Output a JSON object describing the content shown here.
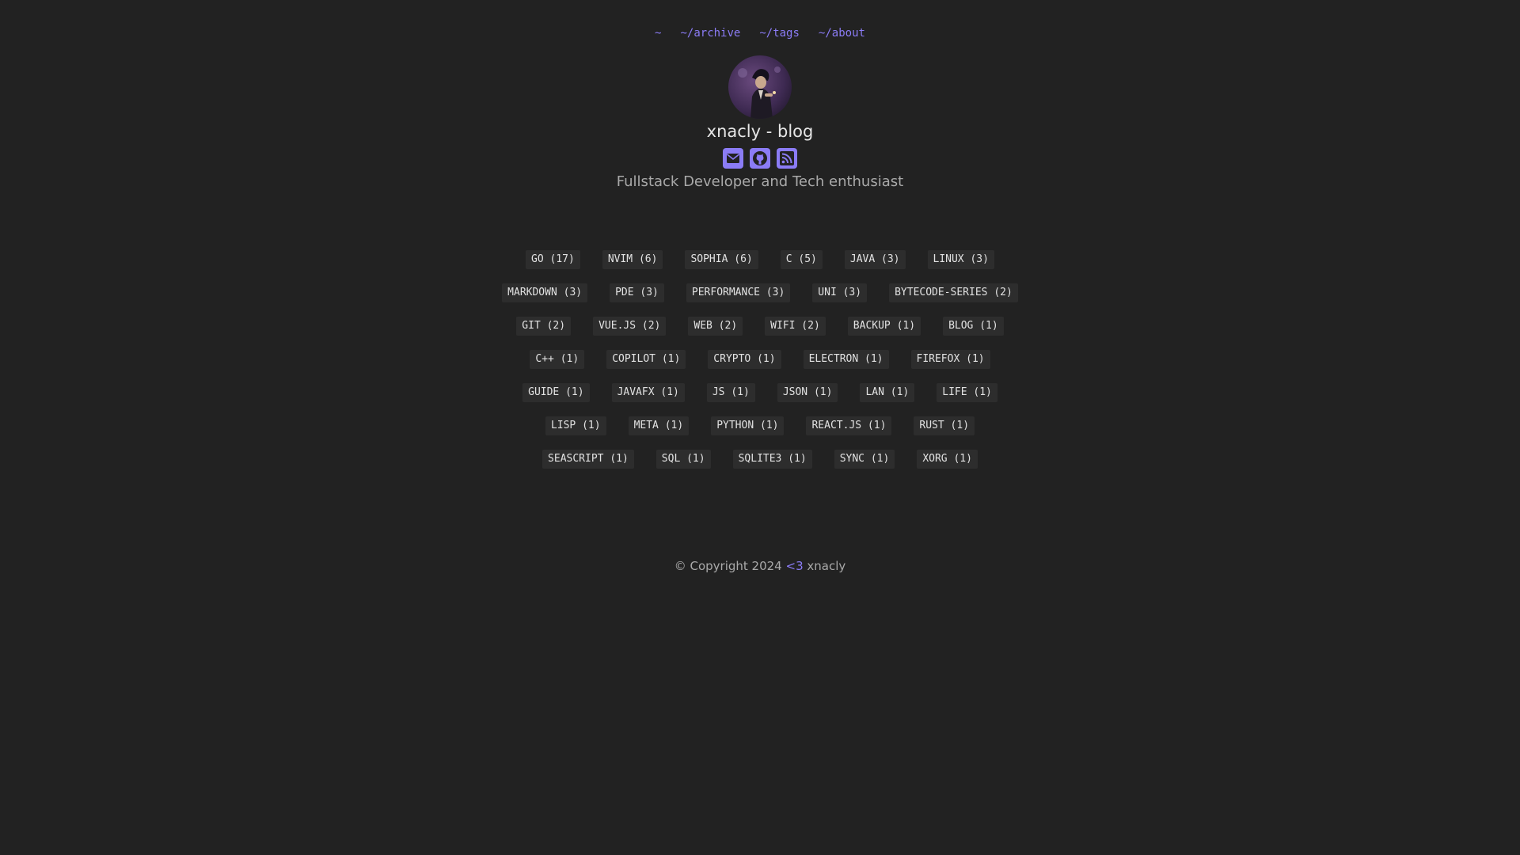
{
  "nav": {
    "items": [
      {
        "label": "~"
      },
      {
        "label": "~/archive"
      },
      {
        "label": "~/tags"
      },
      {
        "label": "~/about"
      }
    ]
  },
  "header": {
    "title": "xnacly - blog",
    "tagline": "Fullstack Developer and Tech enthusiast",
    "social": [
      "mail-icon",
      "github-icon",
      "rss-icon"
    ]
  },
  "tags": {
    "rows": [
      [
        "GO (17)",
        "NVIM (6)",
        "SOPHIA (6)",
        "C (5)",
        "JAVA (3)",
        "LINUX (3)"
      ],
      [
        "MARKDOWN (3)",
        "PDE (3)",
        "PERFORMANCE (3)",
        "UNI (3)",
        "BYTECODE-SERIES (2)"
      ],
      [
        "GIT (2)",
        "VUE.JS (2)",
        "WEB (2)",
        "WIFI (2)",
        "BACKUP (1)",
        "BLOG (1)"
      ],
      [
        "C++ (1)",
        "COPILOT (1)",
        "CRYPTO (1)",
        "ELECTRON (1)",
        "FIREFOX (1)"
      ],
      [
        "GUIDE (1)",
        "JAVAFX (1)",
        "JS (1)",
        "JSON (1)",
        "LAN (1)",
        "LIFE (1)"
      ],
      [
        "LISP (1)",
        "META (1)",
        "PYTHON (1)",
        "REACT.JS (1)",
        "RUST (1)"
      ],
      [
        "SEASCRIPT (1)",
        "SQL (1)",
        "SQLITE3 (1)",
        "SYNC (1)",
        "XORG (1)"
      ]
    ]
  },
  "footer": {
    "prefix": "© Copyright 2024",
    "heart": "<3",
    "name": "xnacly"
  },
  "colors": {
    "background": "#222222",
    "accent": "#8b7cf6",
    "tag_bg": "#2d2d2d"
  }
}
